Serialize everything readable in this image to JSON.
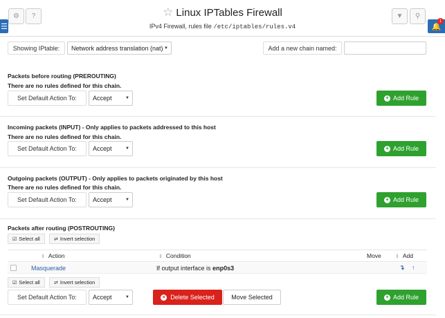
{
  "header": {
    "title": "Linux IPTables Firewall",
    "subtitle_prefix": "IPv4 Firewall, rules file",
    "subtitle_path": "/etc/iptables/rules.v4",
    "notification_count": "1",
    "icons": [
      "gear-icon",
      "help-icon",
      "star-icon",
      "filter-icon",
      "search-icon",
      "menu-icon",
      "bell-icon"
    ]
  },
  "toolbar": {
    "showing_label": "Showing IPtable:",
    "table_select": "Network address translation (nat)",
    "new_chain_label": "Add a new chain named:",
    "new_chain_value": ""
  },
  "common": {
    "set_default_label": "Set Default Action To:",
    "add_rule": "Add Rule",
    "no_rules": "There are no rules defined for this chain."
  },
  "chains": [
    {
      "title": "Packets before routing (PREROUTING)",
      "default_action": "Accept"
    },
    {
      "title": "Incoming packets (INPUT) - Only applies to packets addressed to this host",
      "default_action": "Accept"
    },
    {
      "title": "Outgoing packets (OUTPUT) - Only applies to packets originated by this host",
      "default_action": "Accept"
    },
    {
      "title": "Packets after routing (POSTROUTING)",
      "default_action": "Accept",
      "select_all": "Select all",
      "invert_selection": "Invert selection",
      "columns": {
        "action": "Action",
        "condition": "Condition",
        "move": "Move",
        "add": "Add"
      },
      "rows": [
        {
          "action": "Masquerade",
          "condition_text": "If output interface is",
          "condition_value": "enp0s3",
          "selected": false
        }
      ],
      "delete_selected": "Delete Selected",
      "move_selected": "Move Selected"
    }
  ],
  "colors": {
    "accent": "#2a6db5",
    "green": "#2ea12e",
    "red": "#d9221c",
    "link": "#2a5ea8"
  }
}
